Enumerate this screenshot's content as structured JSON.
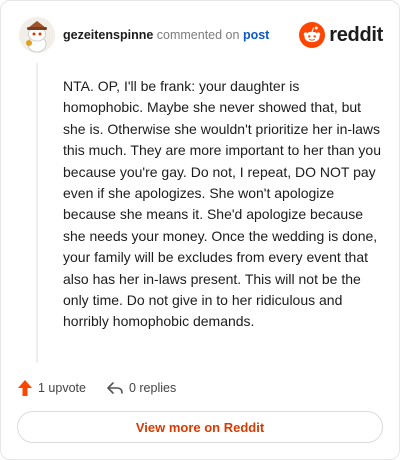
{
  "comment": {
    "username": "gezeitenspinne",
    "action_text": "commented on",
    "target_link": "post",
    "body": "NTA. OP, I'll be frank: your daughter is homophobic. Maybe she never showed that, but she is. Otherwise she wouldn't prioritize her in-laws this much. They are more important to her than you because you're gay. Do not, I repeat, DO NOT pay even if she apologizes. She won't apologize because she means it. She'd apologize because she needs your money. Once the wedding is done, your family will be excludes from every event that also has her in-laws present. This will not be the only time. Do not give in to her ridiculous and horribly homophobic demands."
  },
  "brand": {
    "wordmark": "reddit",
    "accent_color": "#ff4500"
  },
  "actions": {
    "upvote_label": "1 upvote",
    "reply_label": "0 replies"
  },
  "footer": {
    "view_more_label": "View more on Reddit"
  },
  "icons": {
    "avatar": "avatar-icon",
    "logo": "reddit-logo-icon",
    "upvote": "upvote-arrow-icon",
    "reply": "reply-arrow-icon"
  }
}
